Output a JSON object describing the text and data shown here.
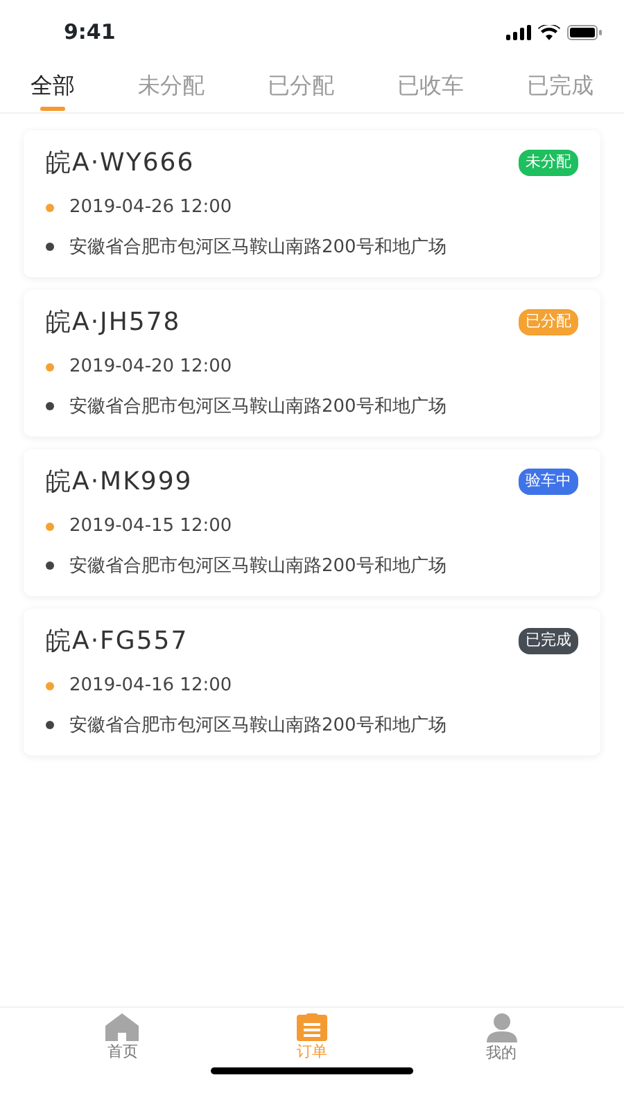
{
  "status_bar": {
    "time": "9:41"
  },
  "tabs": [
    {
      "label": "全部",
      "selected": true
    },
    {
      "label": "未分配",
      "selected": false
    },
    {
      "label": "已分配",
      "selected": false
    },
    {
      "label": "已收车",
      "selected": false
    },
    {
      "label": "已完成",
      "selected": false
    }
  ],
  "orders": [
    {
      "plate": "皖A·WY666",
      "status": "未分配",
      "color": "#1dbf5e",
      "time": "2019-04-26 12:00",
      "address": "安徽省合肥市包河区马鞍山南路200号和地广场"
    },
    {
      "plate": "皖A·JH578",
      "status": "已分配",
      "color": "#f4a233",
      "time": "2019-04-20 12:00",
      "address": "安徽省合肥市包河区马鞍山南路200号和地广场"
    },
    {
      "plate": "皖A·MK999",
      "status": "验车中",
      "color": "#3f73e8",
      "time": "2019-04-15 12:00",
      "address": "安徽省合肥市包河区马鞍山南路200号和地广场"
    },
    {
      "plate": "皖A·FG557",
      "status": "已完成",
      "color": "#474d55",
      "time": "2019-04-16 12:00",
      "address": "安徽省合肥市包河区马鞍山南路200号和地广场"
    }
  ],
  "bottom_nav": [
    {
      "kind": "home",
      "label": "首页",
      "selected": false
    },
    {
      "kind": "orders",
      "label": "订单",
      "selected": true
    },
    {
      "kind": "profile",
      "label": "我的",
      "selected": false
    }
  ]
}
